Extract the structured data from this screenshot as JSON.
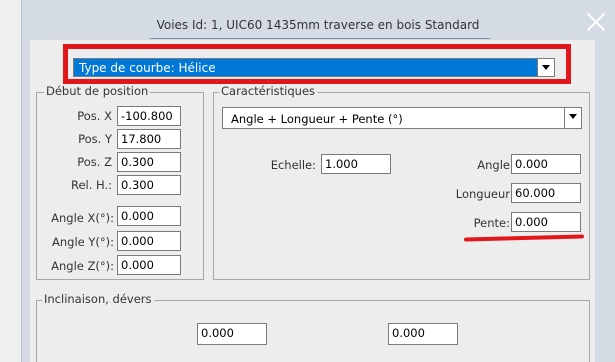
{
  "window": {
    "title": "Voies Id: 1, UIC60 1435mm traverse en bois Standard"
  },
  "curve_type": {
    "selected": "Type de courbe: Hélice"
  },
  "debut": {
    "label": "Début de position",
    "fields": [
      {
        "label": "Pos. X",
        "value": "-100.800"
      },
      {
        "label": "Pos. Y",
        "value": "17.800"
      },
      {
        "label": "Pos. Z",
        "value": "0.300"
      },
      {
        "label": "Rel. H.:",
        "value": "0.300"
      },
      {
        "label": "Angle X(°):",
        "value": "0.000"
      },
      {
        "label": "Angle Y(°):",
        "value": "0.000"
      },
      {
        "label": "Angle Z(°):",
        "value": "0.000"
      }
    ]
  },
  "caracteristiques": {
    "label": "Caractéristiques",
    "mode": "Angle + Longueur + Pente (°)",
    "echelle": {
      "label": "Echelle:",
      "value": "1.000"
    },
    "angle": {
      "label": "Angle",
      "value": "0.000"
    },
    "longueur": {
      "label": "Longueur",
      "value": "60.000"
    },
    "pente": {
      "label": "Pente:",
      "value": "0.000"
    }
  },
  "inclinaison": {
    "label": "Inclinaison, dévers",
    "value1": "0.000",
    "value2": "0.000"
  },
  "colors": {
    "accent": "#0078d7",
    "highlight": "#e3161c"
  }
}
